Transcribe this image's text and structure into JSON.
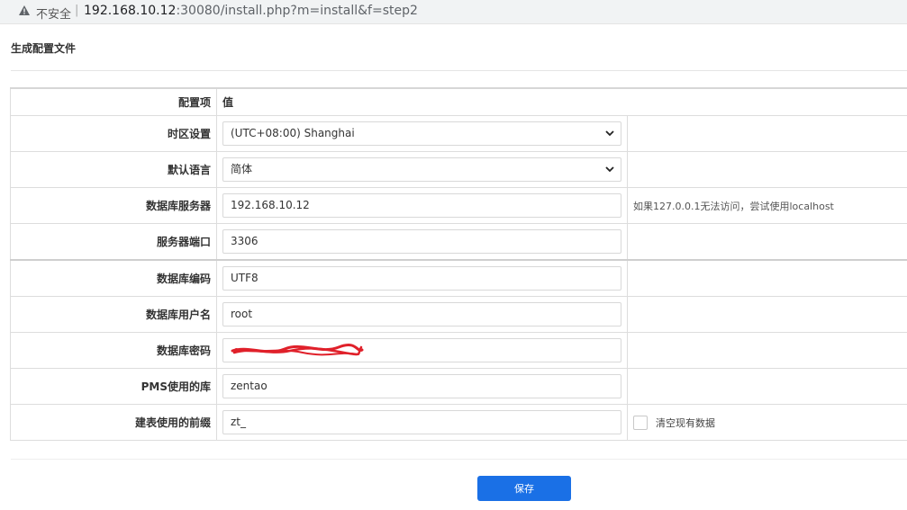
{
  "browser": {
    "security_label": "不安全",
    "separator": "|",
    "url_host": "192.168.10.12",
    "url_path": ":30080/install.php?m=install&f=step2"
  },
  "page": {
    "title": "生成配置文件"
  },
  "table": {
    "header_item": "配置项",
    "header_value": "值",
    "timezone": {
      "label": "时区设置",
      "value": "(UTC+08:00) Shanghai"
    },
    "language": {
      "label": "默认语言",
      "value": "简体"
    },
    "db_host": {
      "label": "数据库服务器",
      "value": "192.168.10.12",
      "hint": "如果127.0.0.1无法访问，尝试使用localhost"
    },
    "db_port": {
      "label": "服务器端口",
      "value": "3306"
    },
    "db_encoding": {
      "label": "数据库编码",
      "value": "UTF8"
    },
    "db_user": {
      "label": "数据库用户名",
      "value": "root"
    },
    "db_password": {
      "label": "数据库密码"
    },
    "db_name": {
      "label": "PMS使用的库",
      "value": "zentao"
    },
    "db_prefix": {
      "label": "建表使用的前缀",
      "value": "zt_",
      "clear_label": "清空现有数据"
    }
  },
  "actions": {
    "save_label": "保存"
  },
  "colors": {
    "accent": "#1a70e6",
    "redaction": "#e0202a"
  }
}
